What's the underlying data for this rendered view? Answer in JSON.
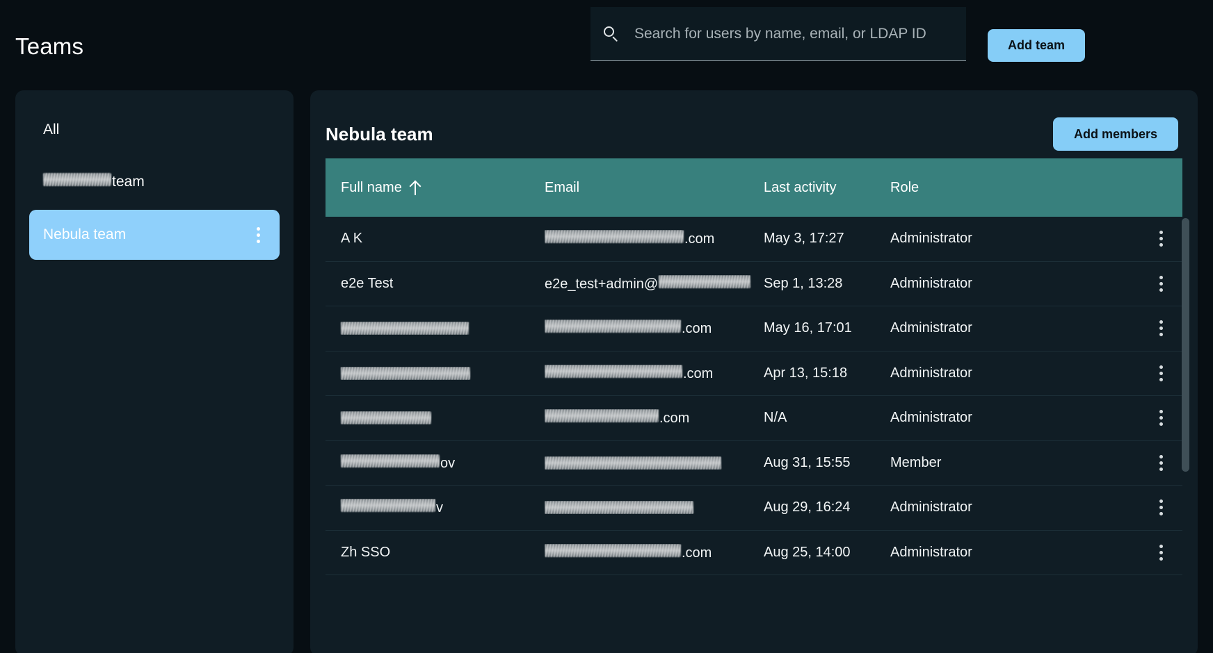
{
  "header": {
    "title": "Teams",
    "search": {
      "placeholder": "Search for users by name, email, or LDAP ID",
      "value": "",
      "icon": "search-icon"
    },
    "add_team_label": "Add team"
  },
  "sidebar": {
    "items": [
      {
        "label": "All",
        "redacted_prefix": false,
        "selected": false,
        "has_menu": false
      },
      {
        "label": "team",
        "redacted_prefix": true,
        "redact_width": 98,
        "selected": false,
        "has_menu": false
      },
      {
        "label": "Nebula team",
        "redacted_prefix": false,
        "selected": true,
        "has_menu": true,
        "menu_icon": "kebab-menu-icon"
      }
    ]
  },
  "main": {
    "title": "Nebula team",
    "add_members_label": "Add members",
    "table": {
      "columns": [
        {
          "label": "Full name",
          "sorted": true,
          "sort_icon": "sort-ascending-arrow-icon"
        },
        {
          "label": "Email",
          "sorted": false
        },
        {
          "label": "Last activity",
          "sorted": false
        },
        {
          "label": "Role",
          "sorted": false
        }
      ],
      "rows": [
        {
          "name": "A K",
          "name_redacted": false,
          "name_redact_w": 0,
          "email": ".com",
          "email_redacted": true,
          "email_redact_w": 200,
          "email_suffix_first": true,
          "last_activity": "May 3, 17:27",
          "role": "Administrator"
        },
        {
          "name": "e2e Test",
          "name_redacted": false,
          "name_redact_w": 0,
          "email": "e2e_test+admin@",
          "email_redacted": true,
          "email_redact_w": 132,
          "email_suffix_first": false,
          "last_activity": "Sep 1, 13:28",
          "role": "Administrator"
        },
        {
          "name": "",
          "name_redacted": true,
          "name_redact_w": 184,
          "email": ".com",
          "email_redacted": true,
          "email_redact_w": 196,
          "email_suffix_first": true,
          "last_activity": "May 16, 17:01",
          "role": "Administrator"
        },
        {
          "name": "",
          "name_redacted": true,
          "name_redact_w": 186,
          "email": ".com",
          "email_redacted": true,
          "email_redact_w": 198,
          "email_suffix_first": true,
          "last_activity": "Apr 13, 15:18",
          "role": "Administrator"
        },
        {
          "name": "",
          "name_redacted": true,
          "name_redact_w": 130,
          "email": ".com",
          "email_redacted": true,
          "email_redact_w": 164,
          "email_suffix_first": true,
          "last_activity": "N/A",
          "role": "Administrator"
        },
        {
          "name": "ov",
          "name_redacted": true,
          "name_redact_w": 142,
          "email": "",
          "email_redacted": true,
          "email_redact_w": 254,
          "email_suffix_first": true,
          "last_activity": "Aug 31, 15:55",
          "role": "Member"
        },
        {
          "name": "v",
          "name_redacted": true,
          "name_redact_w": 136,
          "email": "",
          "email_redacted": true,
          "email_redact_w": 214,
          "email_suffix_first": true,
          "last_activity": "Aug 29, 16:24",
          "role": "Administrator"
        },
        {
          "name": "Zh SSO",
          "name_redacted": false,
          "name_redact_w": 0,
          "email": ".com",
          "email_redacted": true,
          "email_redact_w": 196,
          "email_suffix_first": true,
          "last_activity": "Aug 25, 14:00",
          "role": "Administrator"
        }
      ],
      "row_menu_icon": "kebab-menu-icon"
    },
    "scrollbar": {
      "name": "table-vertical-scrollbar"
    }
  },
  "colors": {
    "page_background": "#070e13",
    "card_background": "#101d25",
    "accent_blue": "#85cdf7",
    "selection_blue": "#8fd0fb",
    "table_header_teal": "#38807d",
    "row_divider": "#1c2e37",
    "scrollbar": "#3f4f57",
    "text_primary": "#ffffff",
    "placeholder_text": "#a8b2b7"
  }
}
